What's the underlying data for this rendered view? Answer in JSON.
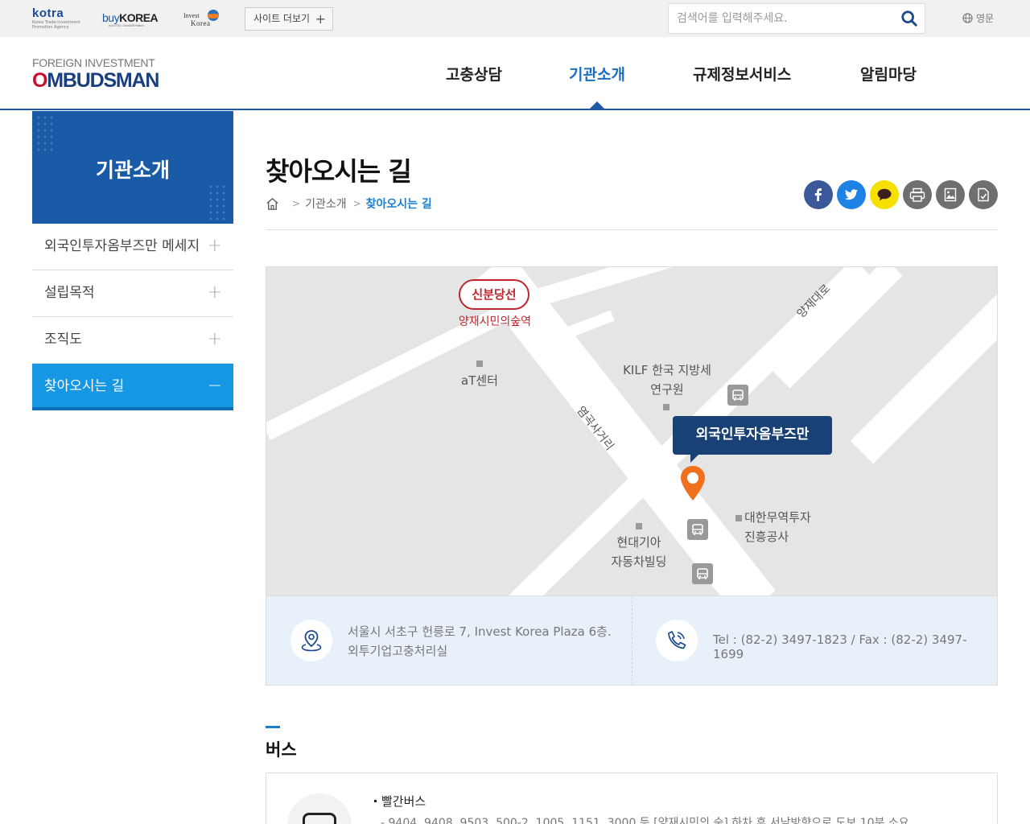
{
  "topbar": {
    "logos": {
      "kotra": "kotra",
      "kotra_sub": "Korea Trade-Investment Promotion Agency",
      "buykorea_buy": "buy",
      "buykorea_korea": "KOREA",
      "buykorea_sub": "by KOTRA · Global B2B Platform",
      "invest_line1": "Invest",
      "invest_line2": "Korea"
    },
    "site_more": "사이트 더보기",
    "search_placeholder": "검색어를 입력해주세요.",
    "lang": "영문"
  },
  "header": {
    "brand_line1": "FOREIGN INVESTMENT",
    "brand_o": "O",
    "brand_rest": "MBUDSMAN",
    "nav": [
      "고충상담",
      "기관소개",
      "규제정보서비스",
      "알림마당"
    ],
    "active_nav": "기관소개"
  },
  "lnb": {
    "title": "기관소개",
    "items": [
      {
        "label": "외국인투자옴부즈만 메세지",
        "toggle": "+"
      },
      {
        "label": "설립목적",
        "toggle": "+"
      },
      {
        "label": "조직도",
        "toggle": "+"
      },
      {
        "label": "찾아오시는 길",
        "toggle": "−"
      }
    ]
  },
  "content": {
    "title": "찾아오시는 길",
    "breadcrumb": [
      "기관소개",
      "찾아오시는 길"
    ],
    "share": [
      {
        "icon": "facebook-icon",
        "color": "#3b5998"
      },
      {
        "icon": "twitter-icon",
        "color": "#1d82e3"
      },
      {
        "icon": "kakao-icon",
        "color": "#f5e000"
      },
      {
        "icon": "print-icon",
        "color": "#6f6f6f"
      },
      {
        "icon": "image-icon",
        "color": "#6f6f6f"
      },
      {
        "icon": "document-icon",
        "color": "#6f6f6f"
      }
    ]
  },
  "map": {
    "subway_line": "신분당선",
    "subway_station": "양재시민의숲역",
    "landmarks": {
      "at_center": "aT센터",
      "kilf_1": "KILF 한국 지방세",
      "kilf_2": "연구원",
      "hyundai_1": "현대기아",
      "hyundai_2": "자동차빌딩",
      "kotra_1": "대한무역투자",
      "kotra_2": "진흥공사"
    },
    "roads": {
      "yangjae": "양재대로",
      "yeomgok": "염곡사거리"
    },
    "callout": "외국인투자옴부즈만"
  },
  "info": {
    "address_line1": "서울시 서초구 헌릉로 7, Invest Korea Plaza 6층.",
    "address_line2": "외투기업고충처리실",
    "tel": "Tel : (82-2) 3497-1823 / Fax : (82-2) 3497-1699"
  },
  "bus": {
    "section_title": "버스",
    "type": "빨간버스",
    "detail": "- 9404, 9408, 9503, 500-2, 1005, 1151, 3000 등 [양재시민의 숲] 하차 후 서남방향으로 도보 10분 소요"
  }
}
